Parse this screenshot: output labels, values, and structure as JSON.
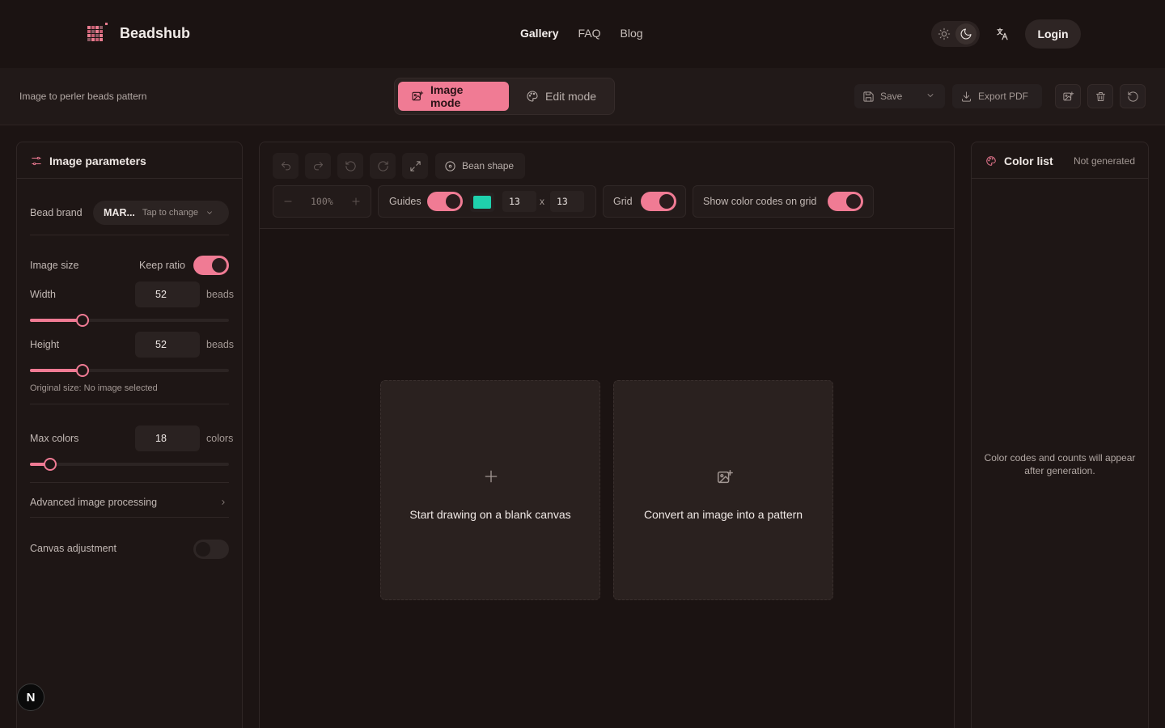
{
  "header": {
    "brand": "Beadshub",
    "nav": [
      {
        "label": "Gallery",
        "active": true
      },
      {
        "label": "FAQ",
        "active": false
      },
      {
        "label": "Blog",
        "active": false
      }
    ],
    "theme_icons": [
      "sun-icon",
      "moon-icon"
    ],
    "translate_icon": "translate-icon",
    "login_label": "Login"
  },
  "toolbar": {
    "caption": "Image to perler beads pattern",
    "modes": [
      {
        "label": "Image mode",
        "active": true,
        "icon": "image-edit-icon"
      },
      {
        "label": "Edit mode",
        "active": false,
        "icon": "palette-icon"
      }
    ],
    "save_label": "Save",
    "export_label": "Export PDF",
    "icon_buttons": [
      "image-add-icon",
      "trash-icon",
      "reset-icon"
    ]
  },
  "image_params": {
    "title": "Image parameters",
    "bead_brand_label": "Bead brand",
    "bead_brand_value": "MAR...",
    "bead_brand_hint": "Tap to change",
    "image_size_label": "Image size",
    "keep_ratio_label": "Keep ratio",
    "keep_ratio_on": true,
    "width_label": "Width",
    "width_value": "52",
    "width_unit": "beads",
    "width_slider_fraction": 0.265,
    "height_label": "Height",
    "height_value": "52",
    "height_unit": "beads",
    "height_slider_fraction": 0.265,
    "original_size_text": "Original size: No image selected",
    "max_colors_label": "Max colors",
    "max_colors_value": "18",
    "max_colors_unit": "colors",
    "max_colors_slider_fraction": 0.1,
    "advanced_label": "Advanced image processing",
    "canvas_adjust_label": "Canvas adjustment",
    "canvas_adjust_on": false
  },
  "workspace": {
    "bean_shape_label": "Bean shape",
    "zoom_value": "100%",
    "guides_label": "Guides",
    "guides_on": true,
    "guide_color": "#1fd1ad",
    "guide_cols": "13",
    "guide_times": "x",
    "guide_rows": "13",
    "grid_label": "Grid",
    "grid_on": true,
    "show_codes_label": "Show color codes on grid",
    "show_codes_on": true,
    "blank_canvas_label": "Start drawing on a blank canvas",
    "convert_image_label": "Convert an image into a pattern"
  },
  "color_list": {
    "title": "Color list",
    "status": "Not generated",
    "empty_text": "Color codes and counts will appear after generation."
  },
  "badge": "N",
  "colors": {
    "accent": "#f07b94",
    "background": "#1c1413",
    "panel": "#1e1615"
  }
}
